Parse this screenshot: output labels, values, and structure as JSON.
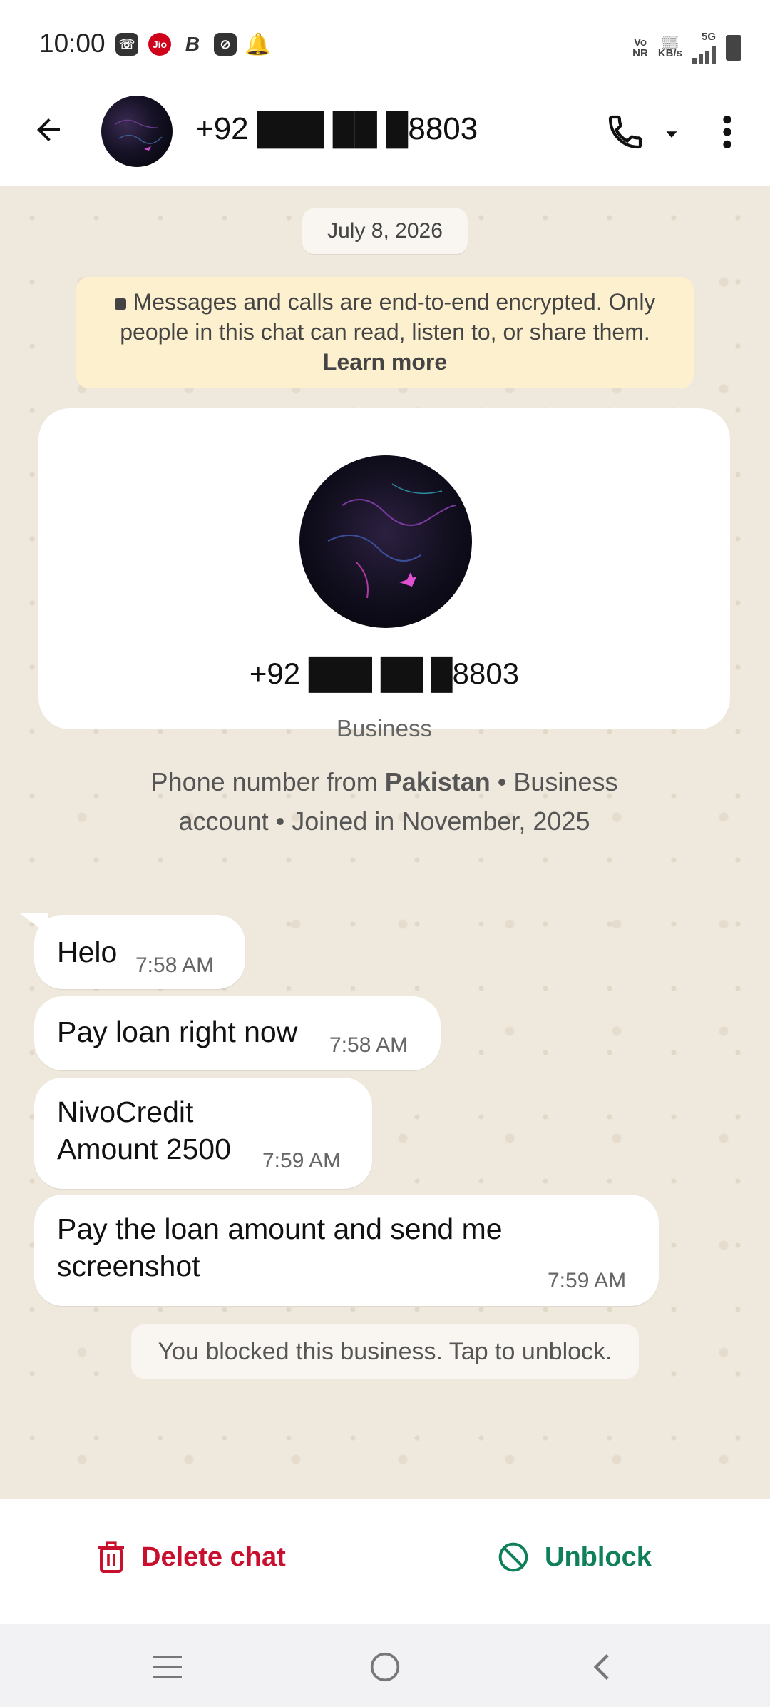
{
  "status_bar": {
    "time": "10:00",
    "left_icons": [
      "call-icon",
      "jio-icon",
      "b-icon",
      "app-icon",
      "notification-icon"
    ],
    "jio_label": "Jio",
    "b_label": "B",
    "right_vo": "Vo",
    "right_nr": "NR",
    "right_kbs": "KB/s",
    "right_network": "5G"
  },
  "header": {
    "title": "+92 ███ ██ █8803",
    "icons": {
      "back": "arrow-left-icon",
      "call": "phone-icon",
      "dropdown": "caret-down-icon",
      "more": "more-vertical-icon"
    }
  },
  "chat": {
    "date_chip": "July 8, 2026",
    "encryption": {
      "text": "Messages and calls are end-to-end encrypted. Only people in this chat can read, listen to, or share them.",
      "link": "Learn more"
    },
    "profile_card": {
      "phone": "+92 ███ ██ █8803",
      "type": "Business",
      "desc_prefix": "Phone number from ",
      "desc_country": "Pakistan",
      "desc_suffix": " • Business account • Joined in November, 2025"
    },
    "messages": [
      {
        "text": "Helo",
        "time": "7:58 AM"
      },
      {
        "text": "Pay loan right now",
        "time": "7:58 AM"
      },
      {
        "line1": "NivoCredit",
        "line2": "Amount 2500",
        "time": "7:59 AM"
      },
      {
        "line1": "Pay the loan amount and send me",
        "line2": "screenshot",
        "time": "7:59 AM"
      }
    ],
    "blocked_notice": "You blocked this business. Tap to unblock."
  },
  "actions": {
    "delete_label": "Delete chat",
    "unblock_label": "Unblock",
    "colors": {
      "delete": "#c8102e",
      "unblock": "#10805a"
    }
  },
  "nav": {
    "icons": [
      "menu-icon",
      "home-icon",
      "back-icon"
    ]
  }
}
